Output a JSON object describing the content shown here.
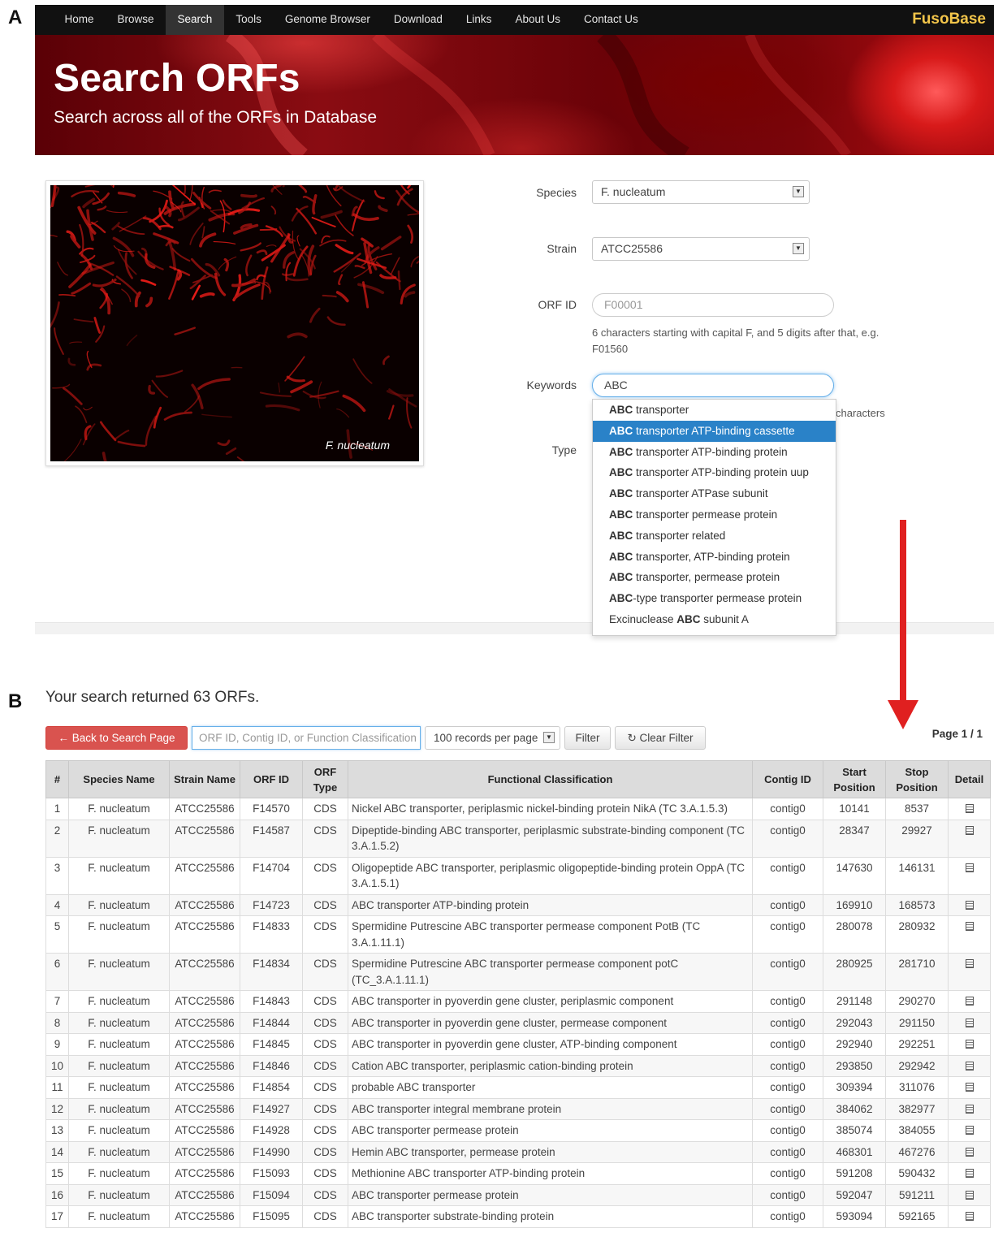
{
  "panels": {
    "a": "A",
    "b": "B"
  },
  "nav": {
    "items": [
      "Home",
      "Browse",
      "Search",
      "Tools",
      "Genome Browser",
      "Download",
      "Links",
      "About Us",
      "Contact Us"
    ],
    "active": "Search",
    "brand": "FusoBase"
  },
  "hero": {
    "title": "Search ORFs",
    "subtitle": "Search across all of the ORFs in Database"
  },
  "image": {
    "caption": "F. nucleatum"
  },
  "form": {
    "species_label": "Species",
    "species_value": "F. nucleatum",
    "strain_label": "Strain",
    "strain_value": "ATCC25586",
    "orf_label": "ORF ID",
    "orf_placeholder": "F00001",
    "orf_help": "6 characters starting with capital F, and 5 digits after that, e.g. F01560",
    "keywords_label": "Keywords",
    "keywords_value": "ABC",
    "keywords_help_partial": "characters",
    "type_label": "Type"
  },
  "autocomplete": {
    "selected_index": 1,
    "items": [
      {
        "bold": "ABC",
        "rest": " transporter",
        "prefix": ""
      },
      {
        "bold": "ABC",
        "rest": " transporter ATP-binding cassette",
        "prefix": ""
      },
      {
        "bold": "ABC",
        "rest": " transporter ATP-binding protein",
        "prefix": ""
      },
      {
        "bold": "ABC",
        "rest": " transporter ATP-binding protein uup",
        "prefix": ""
      },
      {
        "bold": "ABC",
        "rest": " transporter ATPase subunit",
        "prefix": ""
      },
      {
        "bold": "ABC",
        "rest": " transporter permease protein",
        "prefix": ""
      },
      {
        "bold": "ABC",
        "rest": " transporter related",
        "prefix": ""
      },
      {
        "bold": "ABC",
        "rest": " transporter, ATP-binding protein",
        "prefix": ""
      },
      {
        "bold": "ABC",
        "rest": " transporter, permease protein",
        "prefix": ""
      },
      {
        "bold": "ABC",
        "rest": "-type transporter permease protein",
        "prefix": ""
      },
      {
        "bold": "ABC",
        "rest": " subunit A",
        "prefix": "Excinuclease "
      }
    ]
  },
  "results": {
    "summary": "Your search returned 63 ORFs.",
    "back_button": "← Back to Search Page",
    "filter_placeholder": "ORF ID, Contig ID, or Function Classification",
    "records_per_page": "100 records per page",
    "filter_button": "Filter",
    "clear_button": "↻ Clear Filter",
    "page_indicator": "Page 1 / 1",
    "columns": [
      "#",
      "Species Name",
      "Strain Name",
      "ORF ID",
      "ORF Type",
      "Functional Classification",
      "Contig ID",
      "Start Position",
      "Stop Position",
      "Detail"
    ],
    "rows": [
      [
        "1",
        "F. nucleatum",
        "ATCC25586",
        "F14570",
        "CDS",
        "Nickel ABC transporter, periplasmic nickel-binding protein NikA (TC 3.A.1.5.3)",
        "contig0",
        "10141",
        "8537"
      ],
      [
        "2",
        "F. nucleatum",
        "ATCC25586",
        "F14587",
        "CDS",
        "Dipeptide-binding ABC transporter, periplasmic substrate-binding component (TC 3.A.1.5.2)",
        "contig0",
        "28347",
        "29927"
      ],
      [
        "3",
        "F. nucleatum",
        "ATCC25586",
        "F14704",
        "CDS",
        "Oligopeptide ABC transporter, periplasmic oligopeptide-binding protein OppA (TC 3.A.1.5.1)",
        "contig0",
        "147630",
        "146131"
      ],
      [
        "4",
        "F. nucleatum",
        "ATCC25586",
        "F14723",
        "CDS",
        "ABC transporter ATP-binding protein",
        "contig0",
        "169910",
        "168573"
      ],
      [
        "5",
        "F. nucleatum",
        "ATCC25586",
        "F14833",
        "CDS",
        "Spermidine Putrescine ABC transporter permease component PotB (TC 3.A.1.11.1)",
        "contig0",
        "280078",
        "280932"
      ],
      [
        "6",
        "F. nucleatum",
        "ATCC25586",
        "F14834",
        "CDS",
        "Spermidine Putrescine ABC transporter permease component potC (TC_3.A.1.11.1)",
        "contig0",
        "280925",
        "281710"
      ],
      [
        "7",
        "F. nucleatum",
        "ATCC25586",
        "F14843",
        "CDS",
        "ABC transporter in pyoverdin gene cluster, periplasmic component",
        "contig0",
        "291148",
        "290270"
      ],
      [
        "8",
        "F. nucleatum",
        "ATCC25586",
        "F14844",
        "CDS",
        "ABC transporter in pyoverdin gene cluster, permease component",
        "contig0",
        "292043",
        "291150"
      ],
      [
        "9",
        "F. nucleatum",
        "ATCC25586",
        "F14845",
        "CDS",
        "ABC transporter in pyoverdin gene cluster, ATP-binding component",
        "contig0",
        "292940",
        "292251"
      ],
      [
        "10",
        "F. nucleatum",
        "ATCC25586",
        "F14846",
        "CDS",
        "Cation ABC transporter, periplasmic cation-binding protein",
        "contig0",
        "293850",
        "292942"
      ],
      [
        "11",
        "F. nucleatum",
        "ATCC25586",
        "F14854",
        "CDS",
        "probable ABC transporter",
        "contig0",
        "309394",
        "311076"
      ],
      [
        "12",
        "F. nucleatum",
        "ATCC25586",
        "F14927",
        "CDS",
        "ABC transporter integral membrane protein",
        "contig0",
        "384062",
        "382977"
      ],
      [
        "13",
        "F. nucleatum",
        "ATCC25586",
        "F14928",
        "CDS",
        "ABC transporter permease protein",
        "contig0",
        "385074",
        "384055"
      ],
      [
        "14",
        "F. nucleatum",
        "ATCC25586",
        "F14990",
        "CDS",
        "Hemin ABC transporter, permease protein",
        "contig0",
        "468301",
        "467276"
      ],
      [
        "15",
        "F. nucleatum",
        "ATCC25586",
        "F15093",
        "CDS",
        "Methionine ABC transporter ATP-binding protein",
        "contig0",
        "591208",
        "590432"
      ],
      [
        "16",
        "F. nucleatum",
        "ATCC25586",
        "F15094",
        "CDS",
        "ABC transporter permease protein",
        "contig0",
        "592047",
        "591211"
      ],
      [
        "17",
        "F. nucleatum",
        "ATCC25586",
        "F15095",
        "CDS",
        "ABC transporter substrate-binding protein",
        "contig0",
        "593094",
        "592165"
      ]
    ]
  },
  "colors": {
    "navbar": "#111111",
    "brand": "#f3c54a",
    "hero": "#8a0c12",
    "selected_item": "#2a82c8",
    "back_button": "#d9534f",
    "arrow": "#e02020",
    "table_header": "#dcdcdc"
  },
  "icons": [
    "select-arrow-icon",
    "detail-list-icon",
    "arrow-left-icon",
    "refresh-icon",
    "red-down-arrow-icon"
  ]
}
